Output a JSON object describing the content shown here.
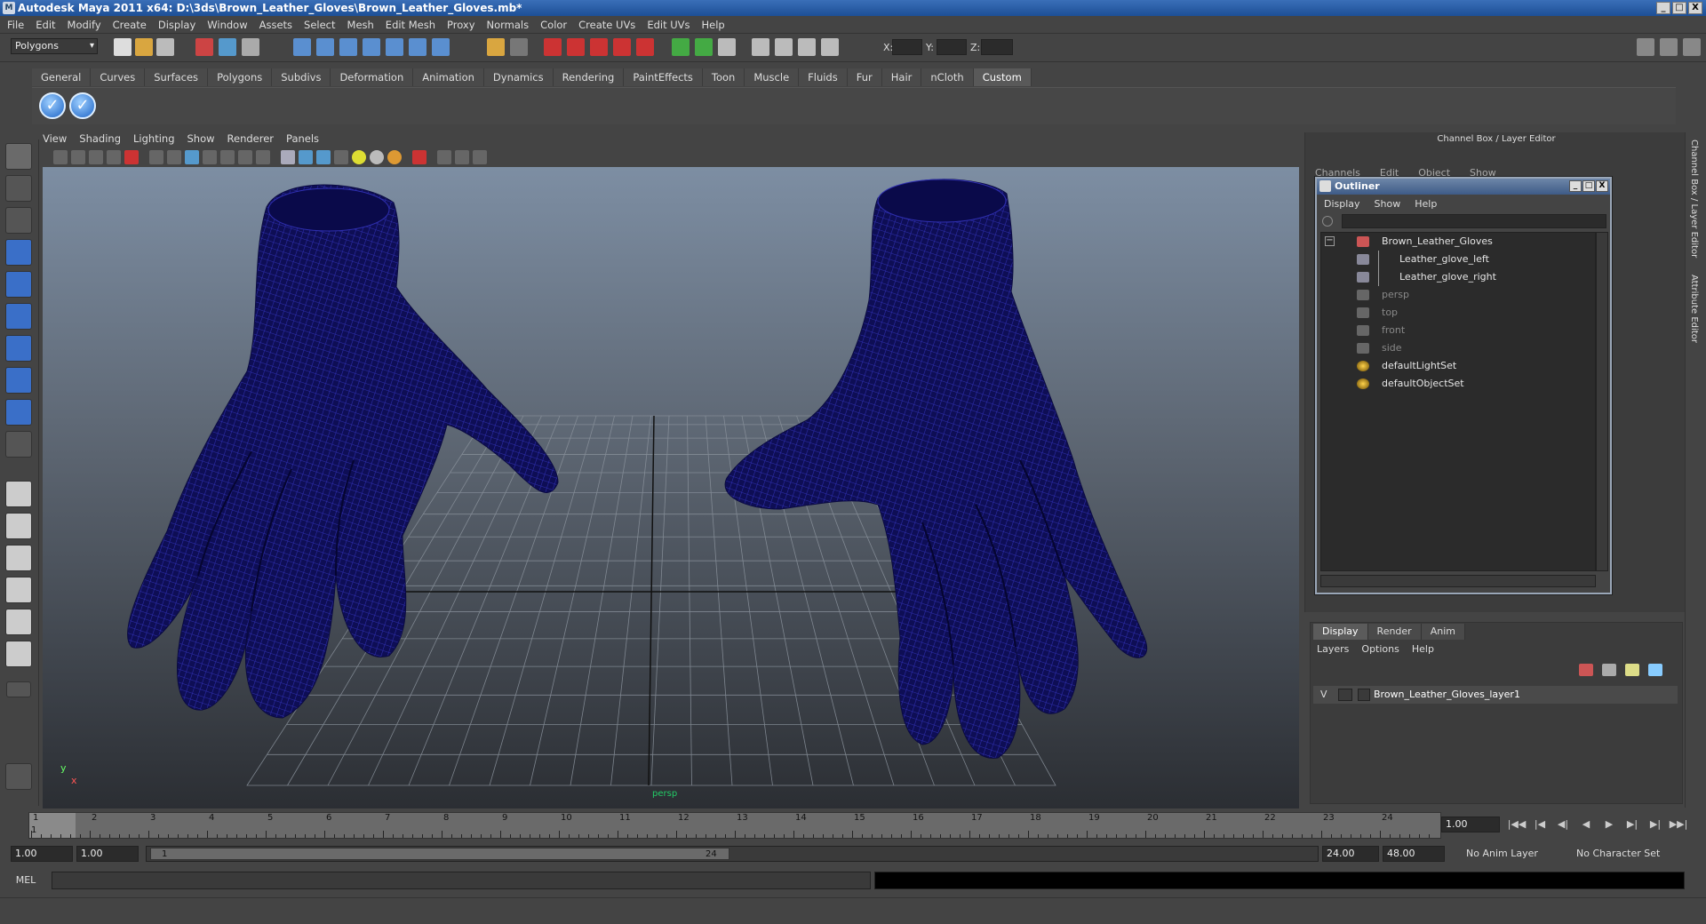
{
  "window": {
    "title": "Autodesk Maya 2011 x64: D:\\3ds\\Brown_Leather_Gloves\\Brown_Leather_Gloves.mb*",
    "min": "_",
    "max": "□",
    "close": "X"
  },
  "menubar": [
    "File",
    "Edit",
    "Modify",
    "Create",
    "Display",
    "Window",
    "Assets",
    "Select",
    "Mesh",
    "Edit Mesh",
    "Proxy",
    "Normals",
    "Color",
    "Create UVs",
    "Edit UVs",
    "Help"
  ],
  "statusline": {
    "mode": "Polygons",
    "x_label": "X:",
    "y_label": "Y:",
    "z_label": "Z:"
  },
  "shelf_tabs": [
    "General",
    "Curves",
    "Surfaces",
    "Polygons",
    "Subdivs",
    "Deformation",
    "Animation",
    "Dynamics",
    "Rendering",
    "PaintEffects",
    "Toon",
    "Muscle",
    "Fluids",
    "Fur",
    "Hair",
    "nCloth",
    "Custom"
  ],
  "shelf_active": "Custom",
  "viewport": {
    "menu": [
      "View",
      "Shading",
      "Lighting",
      "Show",
      "Renderer",
      "Panels"
    ],
    "camera_label": "persp",
    "axis_x": "x",
    "axis_y": "y",
    "wire_color": "#14147a"
  },
  "channel_box": {
    "title": "Channel Box / Layer Editor",
    "menu": [
      "Channels",
      "Edit",
      "Object",
      "Show"
    ]
  },
  "outliner": {
    "title": "Outliner",
    "menu": [
      "Display",
      "Show",
      "Help"
    ],
    "items": [
      {
        "label": "Brown_Leather_Gloves",
        "dim": false,
        "icon": "group-icon"
      },
      {
        "label": "Leather_glove_left",
        "dim": false,
        "icon": "mesh-icon"
      },
      {
        "label": "Leather_glove_right",
        "dim": false,
        "icon": "mesh-icon"
      },
      {
        "label": "persp",
        "dim": true,
        "icon": "camera-icon"
      },
      {
        "label": "top",
        "dim": true,
        "icon": "camera-icon"
      },
      {
        "label": "front",
        "dim": true,
        "icon": "camera-icon"
      },
      {
        "label": "side",
        "dim": true,
        "icon": "camera-icon"
      },
      {
        "label": "defaultLightSet",
        "dim": false,
        "icon": "set-icon"
      },
      {
        "label": "defaultObjectSet",
        "dim": false,
        "icon": "set-icon"
      }
    ],
    "collapse": "−"
  },
  "layer_editor": {
    "tabs": [
      "Display",
      "Render",
      "Anim"
    ],
    "active": "Display",
    "menu": [
      "Layers",
      "Options",
      "Help"
    ],
    "layer": {
      "visibility": "V",
      "name": "Brown_Leather_Gloves_layer1"
    }
  },
  "side_tabs": [
    "Channel Box / Layer Editor",
    "Attribute Editor"
  ],
  "timeline": {
    "start_mark": "1",
    "ticks": [
      "1",
      "2",
      "3",
      "4",
      "5",
      "6",
      "7",
      "8",
      "9",
      "10",
      "11",
      "12",
      "13",
      "14",
      "15",
      "16",
      "17",
      "18",
      "19",
      "20",
      "21",
      "22",
      "23",
      "24"
    ],
    "current_frame": "1.00",
    "play_buttons": [
      "|◀◀",
      "|◀",
      "◀|",
      "◀",
      "▶",
      "▶|",
      "▶|",
      "▶▶|"
    ]
  },
  "range": {
    "start": "1.00",
    "range_start": "1.00",
    "slider_start": "1",
    "slider_end": "24",
    "range_end": "24.00",
    "end": "48.00",
    "anim_layer": "No Anim Layer",
    "char_set": "No Character Set"
  },
  "command": {
    "mel_label": "MEL"
  }
}
